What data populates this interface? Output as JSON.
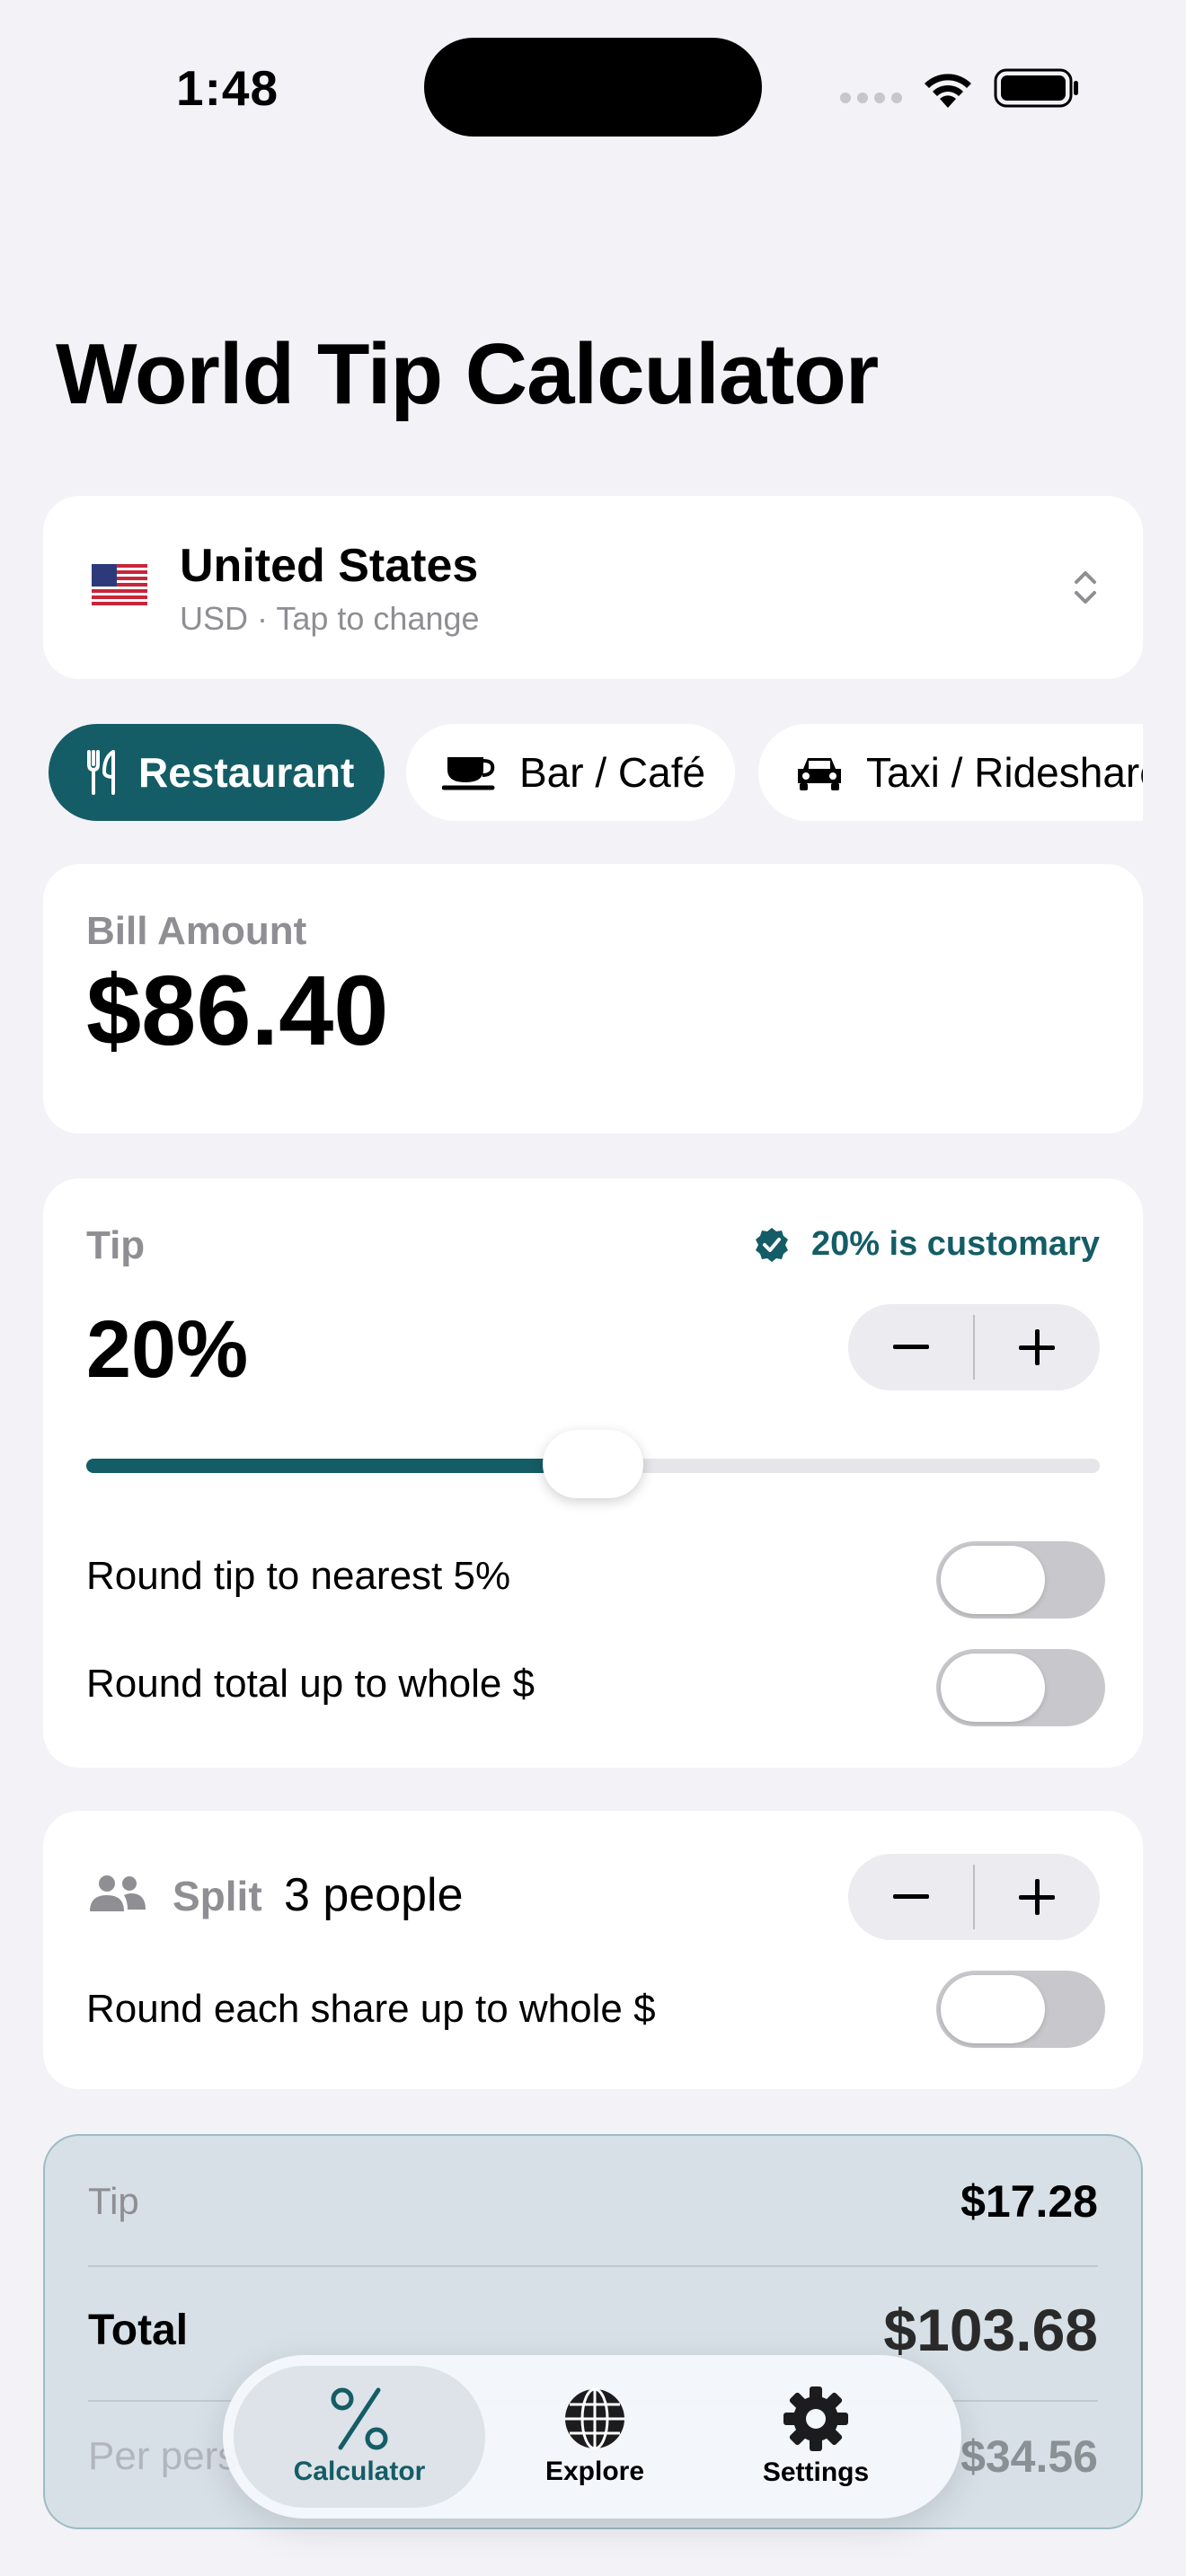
{
  "status_bar": {
    "time": "1:48"
  },
  "page": {
    "title": "World Tip Calculator"
  },
  "country": {
    "flag": "🇺🇸",
    "name": "United States",
    "subtitle": "USD · Tap to change"
  },
  "categories": [
    {
      "label": "Restaurant",
      "icon": "fork-knife-icon",
      "active": true
    },
    {
      "label": "Bar / Café",
      "icon": "cup-icon",
      "active": false
    },
    {
      "label": "Taxi / Rideshare",
      "icon": "car-icon",
      "active": false
    }
  ],
  "bill": {
    "label": "Bill Amount",
    "amount": "$86.40"
  },
  "tip": {
    "label": "Tip",
    "customary_note": "20% is customary",
    "percent": "20%",
    "slider_fraction": 0.5,
    "round_tip_label": "Round tip to nearest 5%",
    "round_tip_on": false,
    "round_total_label": "Round total up to whole $",
    "round_total_on": false
  },
  "split": {
    "label": "Split",
    "count": "3 people",
    "round_share_label": "Round each share up to whole $",
    "round_share_on": false
  },
  "summary": {
    "tip_label": "Tip",
    "tip_value": "$17.28",
    "total_label": "Total",
    "total_value": "$103.68",
    "per_person_label": "Per person",
    "per_person_value": "$34.56"
  },
  "tabs": [
    {
      "label": "Calculator",
      "icon": "percent-icon",
      "active": true
    },
    {
      "label": "Explore",
      "icon": "globe-icon",
      "active": false
    },
    {
      "label": "Settings",
      "icon": "gear-icon",
      "active": false
    }
  ],
  "colors": {
    "accent": "#145d66",
    "background": "#f2f2f7",
    "card": "#ffffff",
    "secondary_text": "#8e8e93"
  }
}
